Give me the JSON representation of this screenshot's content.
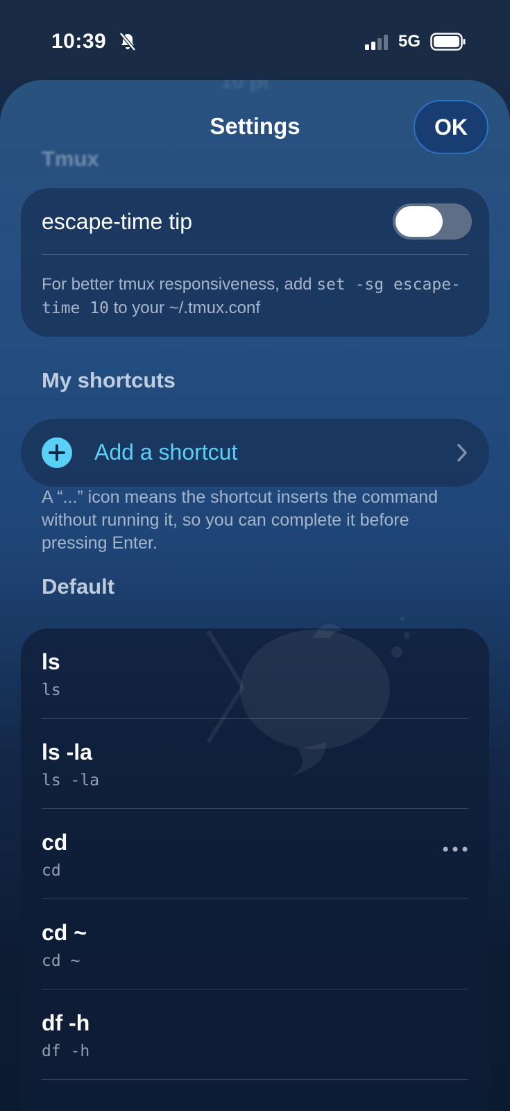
{
  "status_bar": {
    "time": "10:39",
    "network": "5G"
  },
  "sheet": {
    "title": "Settings",
    "ok_label": "OK",
    "ghost_title": "10 pt"
  },
  "tmux": {
    "section_title": "Tmux",
    "toggle_label": "escape-time tip",
    "toggle_on": false,
    "tip_prefix": "For better tmux responsiveness, add ",
    "tip_code": "set -sg escape-time 10",
    "tip_suffix": " to your ~/.tmux.conf"
  },
  "my_shortcuts": {
    "section_title": "My shortcuts",
    "add_label": "Add a shortcut",
    "footnote": "A “...” icon means the shortcut inserts the command without running it, so you can complete it before pressing Enter."
  },
  "default": {
    "section_title": "Default",
    "items": [
      {
        "title": "ls",
        "command": "ls"
      },
      {
        "title": "ls -la",
        "command": "ls -la"
      },
      {
        "title": "cd",
        "command": "cd",
        "insert_only": true
      },
      {
        "title": "cd ~",
        "command": "cd ~"
      },
      {
        "title": "df -h",
        "command": "df -h"
      }
    ]
  },
  "colors": {
    "accent": "#5bd0f7",
    "ok_button": "#173d73"
  },
  "icons": [
    "bell-slash-icon",
    "signal-icon",
    "battery-icon",
    "plus-circle-icon",
    "chevron-right-icon",
    "more-icon",
    "app-watermark-icon"
  ]
}
